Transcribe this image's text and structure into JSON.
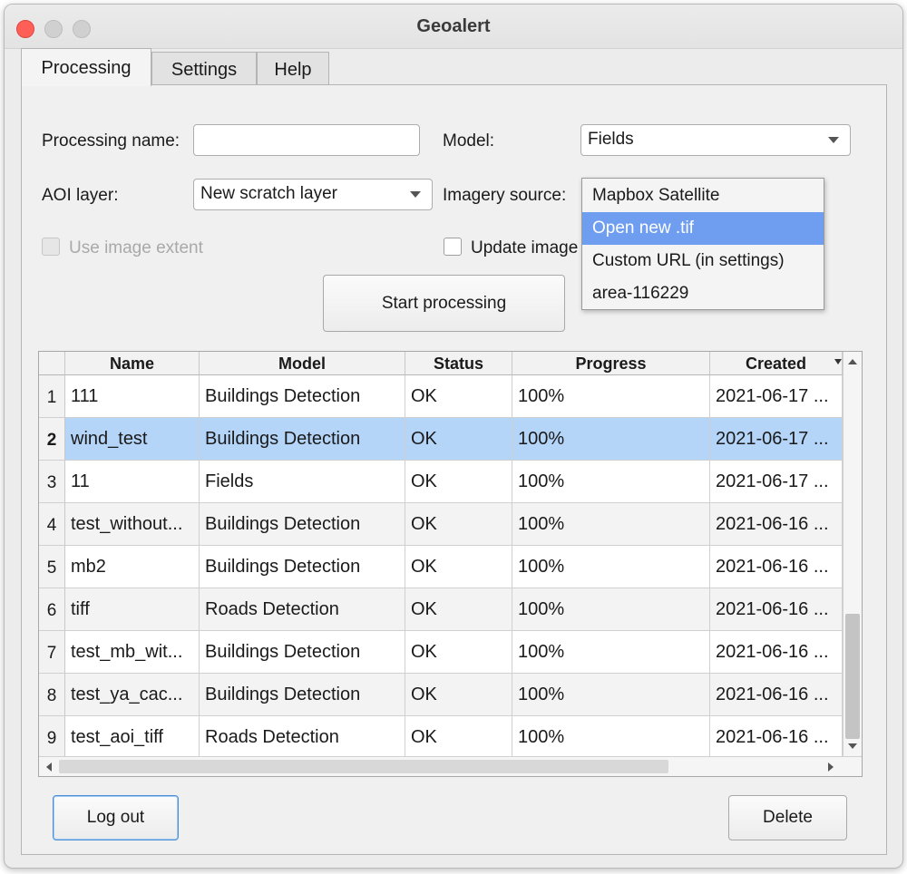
{
  "window": {
    "title": "Geoalert"
  },
  "tabs": [
    {
      "label": "Processing",
      "active": true
    },
    {
      "label": "Settings",
      "active": false
    },
    {
      "label": "Help",
      "active": false
    }
  ],
  "form": {
    "processing_name_label": "Processing name:",
    "processing_name_value": "",
    "model_label": "Model:",
    "model_value": "Fields",
    "aoi_label": "AOI layer:",
    "aoi_value": "New scratch layer",
    "imagery_label": "Imagery source:",
    "use_extent_label": "Use image extent",
    "update_cache_label": "Update image",
    "start_button": "Start processing"
  },
  "imagery_dropdown": {
    "options": [
      "Mapbox Satellite",
      "Open new .tif",
      "Custom URL (in settings)",
      "area-116229"
    ],
    "highlighted_index": 1
  },
  "table": {
    "columns": [
      "Name",
      "Model",
      "Status",
      "Progress",
      "Created"
    ],
    "rows": [
      {
        "num": "1",
        "name": "111",
        "model": "Buildings Detection",
        "status": "OK",
        "progress": "100%",
        "created": "2021-06-17 ..."
      },
      {
        "num": "2",
        "name": "wind_test",
        "model": "Buildings Detection",
        "status": "OK",
        "progress": "100%",
        "created": "2021-06-17 ..."
      },
      {
        "num": "3",
        "name": "11",
        "model": "Fields",
        "status": "OK",
        "progress": "100%",
        "created": "2021-06-17 ..."
      },
      {
        "num": "4",
        "name": "test_without...",
        "model": "Buildings Detection",
        "status": "OK",
        "progress": "100%",
        "created": "2021-06-16 ..."
      },
      {
        "num": "5",
        "name": "mb2",
        "model": "Buildings Detection",
        "status": "OK",
        "progress": "100%",
        "created": "2021-06-16 ..."
      },
      {
        "num": "6",
        "name": "tiff",
        "model": "Roads Detection",
        "status": "OK",
        "progress": "100%",
        "created": "2021-06-16 ..."
      },
      {
        "num": "7",
        "name": "test_mb_wit...",
        "model": "Buildings Detection",
        "status": "OK",
        "progress": "100%",
        "created": "2021-06-16 ..."
      },
      {
        "num": "8",
        "name": "test_ya_cac...",
        "model": "Buildings Detection",
        "status": "OK",
        "progress": "100%",
        "created": "2021-06-16 ..."
      },
      {
        "num": "9",
        "name": "test_aoi_tiff",
        "model": "Roads Detection",
        "status": "OK",
        "progress": "100%",
        "created": "2021-06-16 ..."
      }
    ],
    "selected_row": 2
  },
  "footer": {
    "logout_button": "Log out",
    "delete_button": "Delete"
  },
  "colors": {
    "accent": "#6f9ef0",
    "row_selected": "#b4d4f8",
    "close_button": "#ff5f57"
  }
}
